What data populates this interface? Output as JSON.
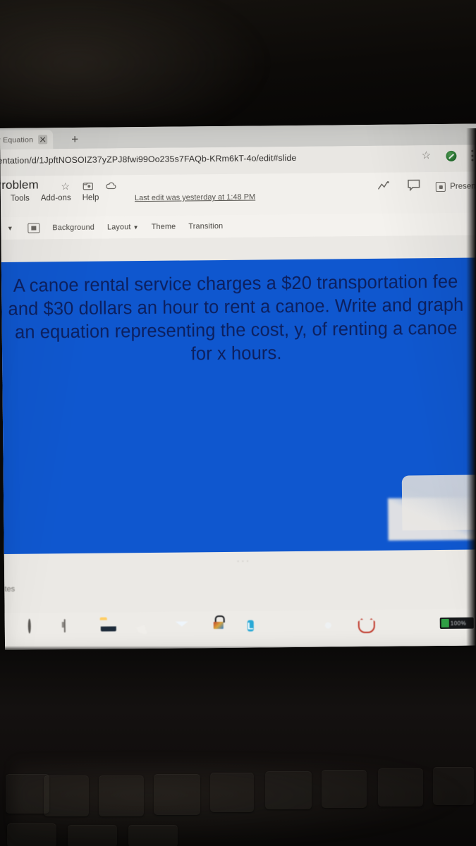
{
  "browser": {
    "tab": {
      "label": "r Equation",
      "close_icon": "close-icon",
      "new_tab_icon": "plus-icon"
    },
    "omnibox": {
      "url": "entation/d/1JpftNOSOIZ37yZPJ8fwi99Oo235s7FAQb-KRm6kT-4o/edit#slide",
      "bookmark_icon": "star-icon",
      "extension_icon": "extension-badge-icon",
      "menu_icon": "three-dots-menu-icon"
    }
  },
  "slides_app": {
    "doc_title": "Problem",
    "title_icons": [
      {
        "name": "star-icon"
      },
      {
        "name": "move-to-folder-icon"
      },
      {
        "name": "cloud-saved-icon"
      }
    ],
    "menus": [
      "Tools",
      "Add-ons",
      "Help"
    ],
    "last_edit": "Last edit was yesterday at 1:48 PM",
    "header_right": {
      "activity_icon": "activity-trend-icon",
      "comment_icon": "comment-icon",
      "present_label": "Present",
      "present_icon": "present-play-icon"
    },
    "toolbar": {
      "caret_icon": "chevron-down-icon",
      "layout_icon": "slide-layout-icon",
      "items": [
        {
          "label": "Background",
          "caret": false
        },
        {
          "label": "Layout",
          "caret": true
        },
        {
          "label": "Theme",
          "caret": false
        },
        {
          "label": "Transition",
          "caret": false
        }
      ]
    },
    "slide": {
      "background_color": "#0f57cf",
      "text_color": "#0c1f5e",
      "body": "A canoe rental service charges a $20 transportation fee and $30 dollars an hour to rent a canoe. Write and graph an equation representing the cost, y, of renting a canoe for x hours."
    },
    "notes": {
      "label": "notes",
      "dots": "..."
    }
  },
  "taskbar": {
    "icons": [
      {
        "name": "cortana-icon"
      },
      {
        "name": "task-view-icon"
      },
      {
        "name": "file-explorer-icon"
      },
      {
        "name": "microsoft-edge-icon"
      },
      {
        "name": "mail-icon"
      },
      {
        "name": "microsoft-store-icon"
      },
      {
        "name": "lockdown-browser-icon",
        "letter": "L"
      },
      {
        "name": "blue-app-icon"
      },
      {
        "name": "google-chrome-icon"
      },
      {
        "name": "red-cat-app-icon"
      }
    ],
    "tray": {
      "badge_icon": "battery-icon",
      "badge_text": "100%"
    }
  }
}
